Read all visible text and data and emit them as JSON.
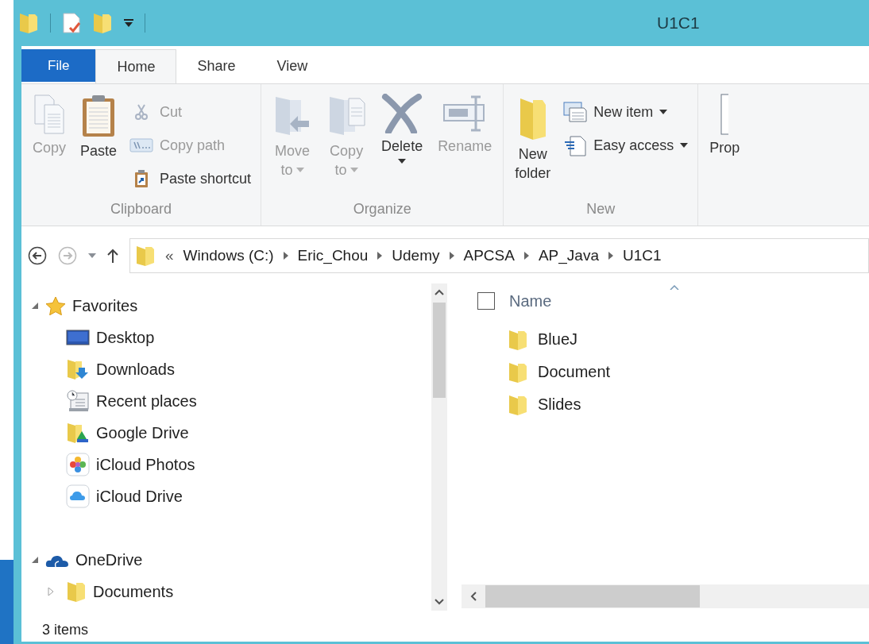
{
  "window": {
    "title": "U1C1"
  },
  "tabs": [
    {
      "label": "File",
      "kind": "file",
      "selected": false
    },
    {
      "label": "Home",
      "kind": "tab",
      "selected": true
    },
    {
      "label": "Share",
      "kind": "tab",
      "selected": false
    },
    {
      "label": "View",
      "kind": "tab",
      "selected": false
    }
  ],
  "ribbon": [
    {
      "label": "Clipboard",
      "commands": [
        {
          "kind": "large",
          "lines": [
            "Copy"
          ],
          "disabled": true,
          "dropdown": false
        },
        {
          "kind": "large",
          "lines": [
            "Paste"
          ],
          "disabled": false,
          "dropdown": false
        },
        {
          "kind": "small",
          "lines": [
            "Cut"
          ],
          "disabled": true,
          "dropdown": false
        },
        {
          "kind": "small",
          "lines": [
            "Copy path"
          ],
          "disabled": true,
          "dropdown": false
        },
        {
          "kind": "small",
          "lines": [
            "Paste shortcut"
          ],
          "disabled": false,
          "dropdown": false
        }
      ]
    },
    {
      "label": "Organize",
      "commands": [
        {
          "kind": "large",
          "lines": [
            "Move",
            "to"
          ],
          "disabled": true,
          "dropdown": true
        },
        {
          "kind": "large",
          "lines": [
            "Copy",
            "to"
          ],
          "disabled": true,
          "dropdown": true
        },
        {
          "kind": "large",
          "lines": [
            "Delete"
          ],
          "disabled": false,
          "dropdown": true
        },
        {
          "kind": "large",
          "lines": [
            "Rename"
          ],
          "disabled": true,
          "dropdown": false
        }
      ]
    },
    {
      "label": "New",
      "commands": [
        {
          "kind": "large",
          "lines": [
            "New",
            "folder"
          ],
          "disabled": false,
          "dropdown": false
        },
        {
          "kind": "small",
          "lines": [
            "New item"
          ],
          "disabled": false,
          "dropdown": true
        },
        {
          "kind": "small",
          "lines": [
            "Easy access"
          ],
          "disabled": false,
          "dropdown": true
        }
      ]
    },
    {
      "commands": [
        {
          "kind": "large",
          "lines": [
            "Prop"
          ],
          "disabled": false,
          "dropdown": false
        }
      ]
    }
  ],
  "address": {
    "back_disabled": false,
    "forward_disabled": true,
    "overflow": "«",
    "path": [
      "Windows (C:)",
      "Eric_Chou",
      "Udemy",
      "APCSA",
      "AP_Java",
      "U1C1"
    ]
  },
  "navigation": [
    {
      "label": "Favorites",
      "expanded": true,
      "children": [
        {
          "label": "Desktop"
        },
        {
          "label": "Downloads"
        },
        {
          "label": "Recent places"
        },
        {
          "label": "Google Drive"
        },
        {
          "label": "iCloud Photos"
        },
        {
          "label": "iCloud Drive"
        }
      ]
    },
    {
      "label": "OneDrive",
      "expanded": true,
      "children": [
        {
          "label": "Documents",
          "expanded": false
        }
      ]
    }
  ],
  "file_list": {
    "column": "Name",
    "select_all_checked": false,
    "items": [
      {
        "name": "BlueJ"
      },
      {
        "name": "Document"
      },
      {
        "name": "Slides"
      }
    ]
  },
  "status_bar": "3 items"
}
